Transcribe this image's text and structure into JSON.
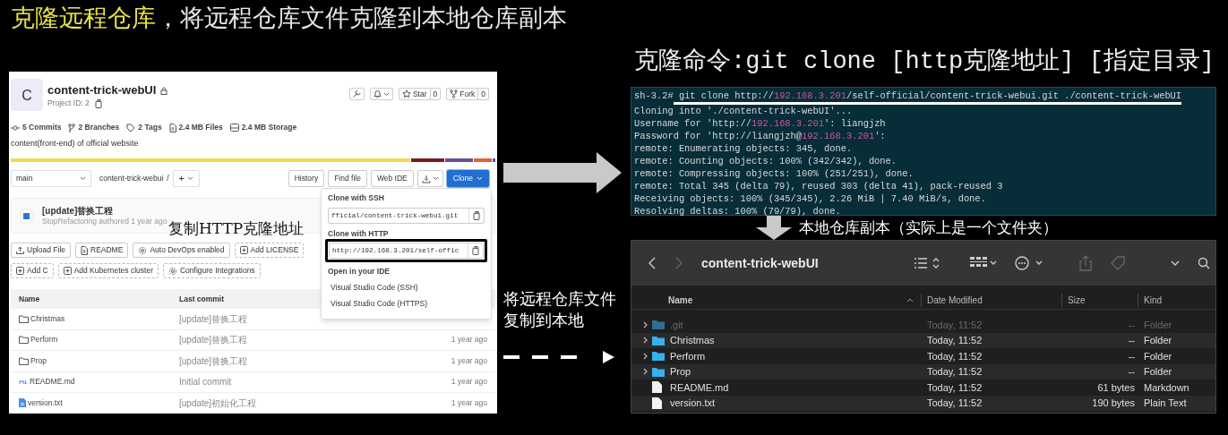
{
  "slide_title": {
    "highlight": "克隆远程仓库",
    "rest": "，将远程仓库文件克隆到本地仓库副本"
  },
  "gitlab": {
    "avatar": "C",
    "project_name": "content-trick-webUI",
    "project_id": "Project ID: 2",
    "star": {
      "label": "Star",
      "count": "0"
    },
    "fork": {
      "label": "Fork",
      "count": "0"
    },
    "stats": [
      "5 Commits",
      "2 Branches",
      "2 Tags",
      "2.4 MB Files",
      "2.4 MB Storage"
    ],
    "description": "content(front-end) of official website",
    "branch": "main",
    "path": "content-trick-webui",
    "path_sep": "/",
    "add_button": "+",
    "toolbar_buttons": [
      "History",
      "Find file",
      "Web IDE"
    ],
    "clone_button": "Clone",
    "last_commit": {
      "message": "[update]替换工程",
      "author_line": "StopRefactoring authored 1 year ago"
    },
    "actions": [
      {
        "label": "Upload File",
        "kind": "upload",
        "dashed": false
      },
      {
        "label": "README",
        "kind": "file",
        "dashed": false
      },
      {
        "label": "Auto DevOps enabled",
        "kind": "settings",
        "dashed": false
      },
      {
        "label": "Add LICENSE",
        "kind": "add",
        "dashed": true
      },
      {
        "label": "Add C",
        "kind": "add",
        "dashed": true
      },
      {
        "label": "Add Kubernetes cluster",
        "kind": "add",
        "dashed": true
      },
      {
        "label": "Configure Integrations",
        "kind": "settings",
        "dashed": true
      }
    ],
    "table": {
      "columns": [
        "Name",
        "Last commit"
      ],
      "rows": [
        {
          "name": "Christmas",
          "kind": "folder",
          "commit": "[update]替换工程"
        },
        {
          "name": "Perform",
          "kind": "folder",
          "commit": "[update]替换工程",
          "time": "1 year ago"
        },
        {
          "name": "Prop",
          "kind": "folder",
          "commit": "[update]替换工程",
          "time": "1 year ago"
        },
        {
          "name": "README.md",
          "kind": "markdown",
          "commit": "Initial commit",
          "time": "1 year ago"
        },
        {
          "name": "version.txt",
          "kind": "text",
          "commit": "[update]初始化工程",
          "time": "1 year ago"
        }
      ]
    },
    "clone_menu": {
      "ssh_label": "Clone with SSH",
      "ssh_url": "fficial/content-trick-webui.git",
      "http_label": "Clone with HTTP",
      "http_url": "http://192.168.3.201/self-offic",
      "ide_label": "Open in your IDE",
      "ide_items": [
        "Visual Studio Code (SSH)",
        "Visual Studio Code (HTTPS)"
      ]
    }
  },
  "annotation_copy": "复制HTTP克隆地址",
  "arrow_note": "将远程仓库文件复制到本地",
  "command_title": "克隆命令:git clone [http克隆地址] [指定目录]",
  "terminal": {
    "prompt": "sh-3.2#",
    "lines": [
      [
        {
          "text": " git clone http://",
          "ip": false
        },
        {
          "text": "192.168.3.201",
          "ip": true
        },
        {
          "text": "/self-official/content-trick-webui.git ./content-trick-webUI",
          "ip": false
        }
      ],
      [
        {
          "text": "Cloning into './content-trick-webUI'...",
          "ip": false
        }
      ],
      [
        {
          "text": "Username for 'http://",
          "ip": false
        },
        {
          "text": "192.168.3.201",
          "ip": true
        },
        {
          "text": "': liangjzh",
          "ip": false
        }
      ],
      [
        {
          "text": "Password for 'http://liangjzh@",
          "ip": false
        },
        {
          "text": "192.168.3.201",
          "ip": true
        },
        {
          "text": "':",
          "ip": false
        }
      ],
      [
        {
          "text": "remote: Enumerating objects: 345, done.",
          "ip": false
        }
      ],
      [
        {
          "text": "remote: Counting objects: 100% (342/342), done.",
          "ip": false
        }
      ],
      [
        {
          "text": "remote: Compressing objects: 100% (251/251), done.",
          "ip": false
        }
      ],
      [
        {
          "text": "remote: Total 345 (delta 79), reused 303 (delta 41), pack-reused 3",
          "ip": false
        }
      ],
      [
        {
          "text": "Receiving objects: 100% (345/345), 2.26 MiB | 7.40 MiB/s, done.",
          "ip": false
        }
      ],
      [
        {
          "text": "Resolving deltas: 100% (79/79), done.",
          "ip": false
        }
      ]
    ]
  },
  "down_note": "本地仓库副本（实际上是一个文件夹）",
  "finder": {
    "title": "content-trick-webUI",
    "columns": [
      "Name",
      "Date Modified",
      "Size",
      "Kind"
    ],
    "rows": [
      {
        "name": ".git",
        "kind": "folder",
        "hidden": true,
        "date": "Today, 11:52",
        "size": "--",
        "type": "Folder"
      },
      {
        "name": "Christmas",
        "kind": "folder",
        "hidden": false,
        "date": "Today, 11:52",
        "size": "--",
        "type": "Folder"
      },
      {
        "name": "Perform",
        "kind": "folder",
        "hidden": false,
        "date": "Today, 11:52",
        "size": "--",
        "type": "Folder"
      },
      {
        "name": "Prop",
        "kind": "folder",
        "hidden": false,
        "date": "Today, 11:52",
        "size": "--",
        "type": "Folder"
      },
      {
        "name": "README.md",
        "kind": "file",
        "hidden": false,
        "date": "Today, 11:52",
        "size": "61 bytes",
        "type": "Markdown"
      },
      {
        "name": "version.txt",
        "kind": "file",
        "hidden": false,
        "date": "Today, 11:52",
        "size": "190 bytes",
        "type": "Plain Text"
      }
    ]
  }
}
